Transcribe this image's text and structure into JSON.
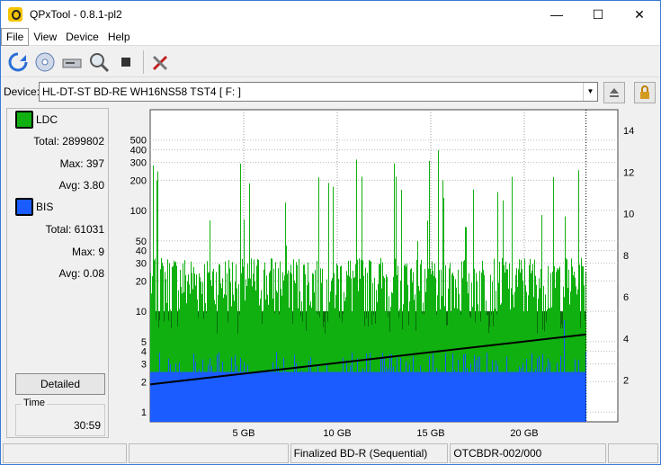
{
  "window": {
    "title": "QPxTool - 0.8.1-pl2",
    "minimize": "—",
    "maximize": "☐",
    "close": "✕"
  },
  "menu": {
    "items": [
      "File",
      "View",
      "Device",
      "Help"
    ]
  },
  "toolbar": {
    "icons": [
      "refresh-icon",
      "disc-scan-icon",
      "drive-icon",
      "zoom-disc-icon",
      "stop-icon",
      "tools-icon"
    ]
  },
  "device": {
    "label": "Device:",
    "value": "HL-DT-ST BD-RE  WH16NS58  TST4 [ F: ]"
  },
  "legend": {
    "ldc": {
      "label": "LDC",
      "color": "#10b010",
      "total_label": "Total:",
      "total": "2899802",
      "max_label": "Max:",
      "max": "397",
      "avg_label": "Avg:",
      "avg": "3.80"
    },
    "bis": {
      "label": "BIS",
      "color": "#1a5cff",
      "total_label": "Total:",
      "total": "61031",
      "max_label": "Max:",
      "max": "9",
      "avg_label": "Avg:",
      "avg": "0.08"
    }
  },
  "detailed_button": "Detailed",
  "time": {
    "title": "Time",
    "value": "30:59"
  },
  "status": {
    "cell3": "Finalized BD-R (Sequential)",
    "cell4": "OTCBDR-002/000"
  },
  "chart_data": {
    "type": "bar",
    "y_left_scale": "log",
    "y_left_ticks": [
      "1",
      "2",
      "3",
      "4",
      "5",
      "10",
      "20",
      "30",
      "40",
      "50",
      "100",
      "200",
      "300",
      "400",
      "500"
    ],
    "y_right_ticks": [
      "2",
      "4",
      "6",
      "8",
      "10",
      "12",
      "14"
    ],
    "x_ticks": [
      "5 GB",
      "10 GB",
      "15 GB",
      "20 GB"
    ],
    "x_range_gb": [
      0,
      25
    ],
    "data_end_gb": 23.3,
    "series": [
      {
        "name": "LDC",
        "color": "#10b010",
        "typical_max": 30,
        "peak": 397
      },
      {
        "name": "BIS",
        "color": "#1a5cff",
        "typical_max": 3,
        "peak": 9
      }
    ],
    "speed_line": {
      "color": "#000000",
      "start": 1.8,
      "end": 4.2
    },
    "grid": true
  }
}
